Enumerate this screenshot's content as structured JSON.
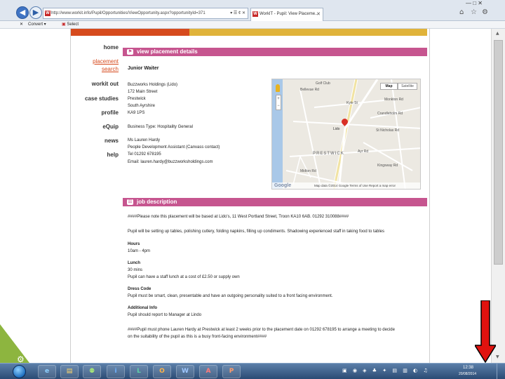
{
  "browser": {
    "address_url": "http://www.workit.info/Pupil/Opportunities/ViewOpportunity.aspx?opportunityId=371",
    "address_controls": "▾ ☰ ¢ ✕",
    "tabs": [
      {
        "label": "WorkIT - Pupil: View Placeme..."
      }
    ],
    "tab_close": "✕",
    "window_controls": "— □ ✕",
    "toolbar": {
      "close_label": "✕",
      "convert_label": "Convert",
      "select_label": "Select"
    }
  },
  "nav": {
    "items": [
      {
        "label": "home"
      },
      {
        "label": "placement"
      },
      {
        "label": "search"
      },
      {
        "label": "workit out"
      },
      {
        "label": "case studies"
      },
      {
        "label": "profile"
      },
      {
        "label": "eQuip"
      },
      {
        "label": "news"
      },
      {
        "label": "help"
      }
    ]
  },
  "placement": {
    "section_title": "view placement details",
    "job_title": "Junior Waiter",
    "address_lines": [
      "Buzzworks Holdings (Lido)",
      "172 Main Street",
      "Prestwick",
      "South Ayrshire",
      "KA9 1PS"
    ],
    "business_type": "Business Type: Hospitality General",
    "contact_name": "Ms Lauren Hardy",
    "contact_role": "People Development Assistant (Canvass contact)",
    "tel": "Tel 01292 678195",
    "email": "Email: lauren.hardy@buzzworksholdings.com"
  },
  "map": {
    "btn_map": "Map",
    "btn_satellite": "Satellite",
    "town_label": "PRESTWICK",
    "marker_label": "Lido",
    "footer": "Map data ©2014 Google   Terms of Use   Report a map error",
    "logo": "Google",
    "street_labels": [
      "Golf Club",
      "Bellevue Rd",
      "Kyle St",
      "Crandleholm Rd",
      "St Nicholas Rd",
      "Monkton Rd",
      "Ayr Rd",
      "Midton Rd",
      "Kingsway Rd"
    ]
  },
  "job": {
    "section_title": "job description",
    "notice": "####Please note this placement will be based at Lido's, 11 West Portland Street, Troon KA10 6AB. 01292 310088####",
    "summary": "Pupil will be setting up tables, polishing cutlery, folding napkins, filling up condiments. Shadowing experienced staff in taking food to tables",
    "hours_heading": "Hours",
    "hours_value": "10am - 4pm",
    "lunch_heading": "Lunch",
    "lunch_value": "30 mins",
    "lunch_note": "Pupil can have a staff lunch at a cost of £2.50 or supply own",
    "dress_heading": "Dress Code",
    "dress_value": "Pupil must be smart, clean, presentable and have an outgoing personality suited to a front facing environment.",
    "info_heading": "Additional Info",
    "info_value": "Pupil should report to Manager at Lindo",
    "final_line_1": "####Pupil must phone Lauren Hardy at Prestwick at least 2 weeks prior to the placement date on 01292 678195 to arrange a meeting to decide",
    "final_line_2": "on the suitability of the pupil as this is a busy front-facing environment####"
  },
  "taskbar": {
    "apps": [
      "e",
      "▤",
      "⚉",
      "i",
      "L",
      "O",
      "W",
      "A",
      "P"
    ],
    "tray_icons": "▣ ◉ ◈ ♣ ✦ ▤ ▥ ◐ ♫",
    "time": "12:38",
    "date": "20/08/2014"
  },
  "colors": {
    "accent_pink": "#c6558f",
    "strip_red": "#d64a1d",
    "strip_yellow": "#e0b33a",
    "nav_active": "#d64a1d",
    "arrow_red": "#e0120f"
  }
}
